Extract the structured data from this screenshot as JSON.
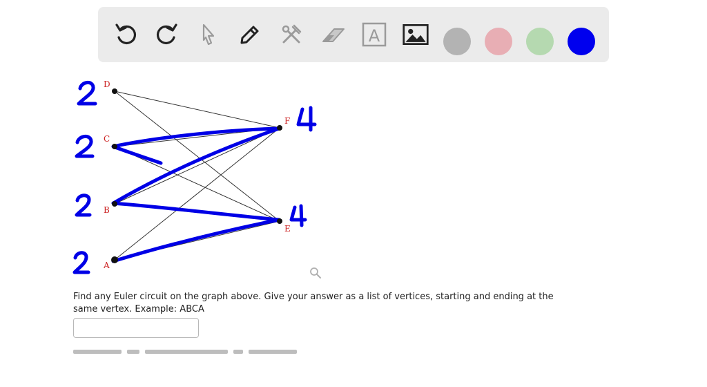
{
  "toolbar": {
    "tools": [
      {
        "name": "undo-icon"
      },
      {
        "name": "redo-icon"
      },
      {
        "name": "pointer-icon"
      },
      {
        "name": "pen-icon"
      },
      {
        "name": "tools-icon"
      },
      {
        "name": "eraser-icon"
      },
      {
        "name": "text-icon",
        "glyph": "A"
      },
      {
        "name": "image-icon"
      }
    ],
    "swatches": [
      "#b3b3b3",
      "#e8aeb4",
      "#b5d9b0",
      "#0000ee"
    ]
  },
  "graph": {
    "vertices": [
      {
        "id": "D",
        "label": "D"
      },
      {
        "id": "C",
        "label": "C"
      },
      {
        "id": "B",
        "label": "B"
      },
      {
        "id": "A",
        "label": "A"
      },
      {
        "id": "F",
        "label": "F"
      },
      {
        "id": "E",
        "label": "E"
      }
    ],
    "degree_annotations": {
      "D": "2",
      "C": "2",
      "B": "2",
      "A": "2",
      "F": "4",
      "E": "4"
    },
    "ink_color": "#0000e6",
    "label_color": "#cc2222"
  },
  "question": {
    "text": "Find any Euler circuit on the graph above. Give your answer as a list of vertices, starting and ending at the same vertex. Example: ABCA"
  },
  "answer": {
    "value": ""
  }
}
